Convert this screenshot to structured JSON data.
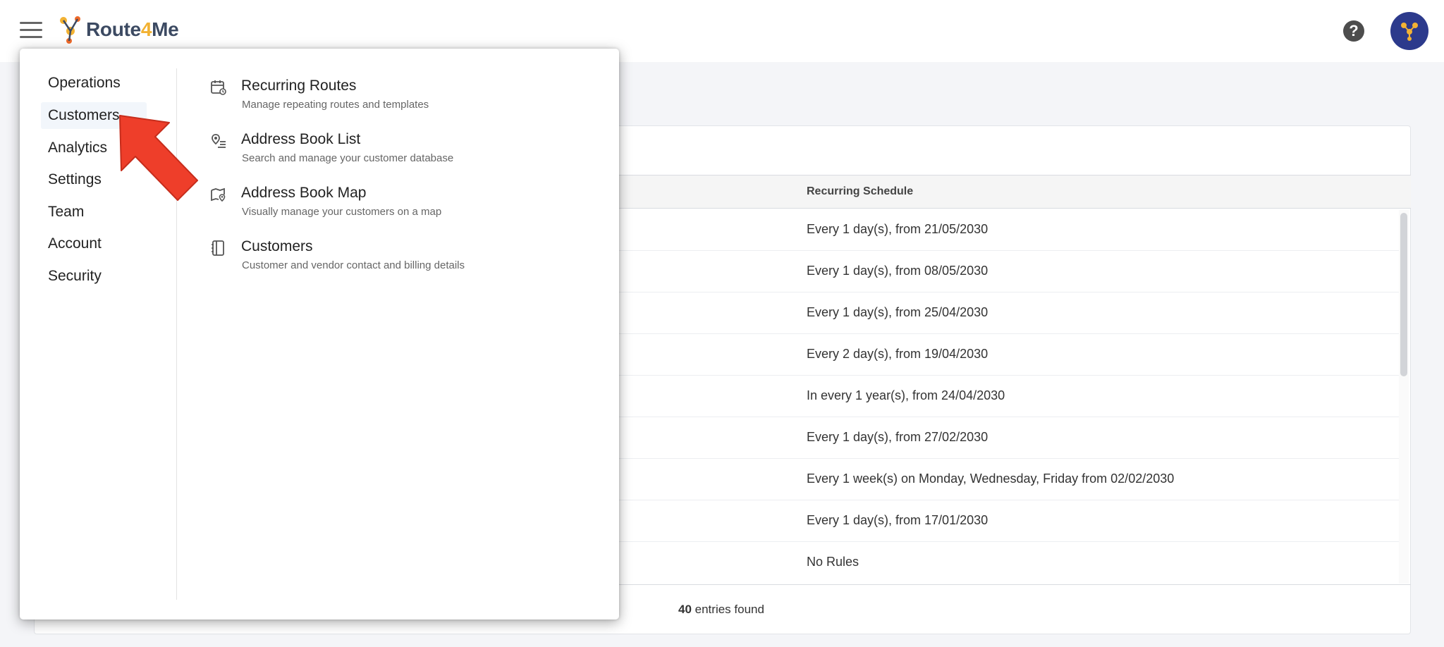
{
  "header": {
    "logo_prefix": "Route",
    "logo_four": "4",
    "logo_suffix": "Me",
    "help_label": "?",
    "icons": {
      "menu": "hamburger-icon",
      "help": "help-icon",
      "avatar": "route4me-avatar-icon"
    },
    "colors": {
      "logo_text": "#3c4a62",
      "logo_accent": "#f2b233",
      "avatar_bg": "#2c3a8c"
    }
  },
  "menu": {
    "categories": [
      {
        "label": "Operations",
        "active": false
      },
      {
        "label": "Customers",
        "active": true
      },
      {
        "label": "Analytics",
        "active": false
      },
      {
        "label": "Settings",
        "active": false
      },
      {
        "label": "Team",
        "active": false
      },
      {
        "label": "Account",
        "active": false
      },
      {
        "label": "Security",
        "active": false
      }
    ],
    "items": [
      {
        "title": "Recurring Routes",
        "description": "Manage repeating routes and templates",
        "icon": "calendar-repeat-icon"
      },
      {
        "title": "Address Book List",
        "description": "Search and manage your customer database",
        "icon": "address-list-icon"
      },
      {
        "title": "Address Book Map",
        "description": "Visually manage your customers on a map",
        "icon": "map-pin-icon"
      },
      {
        "title": "Customers",
        "description": "Customer and vendor contact and billing details",
        "icon": "contact-book-icon"
      }
    ]
  },
  "table": {
    "column_header": "Recurring Schedule",
    "rows": [
      "Every 1 day(s), from 21/05/2030",
      "Every 1 day(s), from 08/05/2030",
      "Every 1 day(s), from 25/04/2030",
      "Every 2 day(s), from 19/04/2030",
      "In every 1 year(s), from 24/04/2030",
      "Every 1 day(s), from 27/02/2030",
      "Every 1 week(s) on Monday, Wednesday, Friday from 02/02/2030",
      "Every 1 day(s), from 17/01/2030",
      "No Rules"
    ],
    "entries_count": "40",
    "entries_label": " entries found"
  },
  "annotation": {
    "icon": "red-pointer-arrow-icon",
    "color": "#ee3e2a"
  }
}
